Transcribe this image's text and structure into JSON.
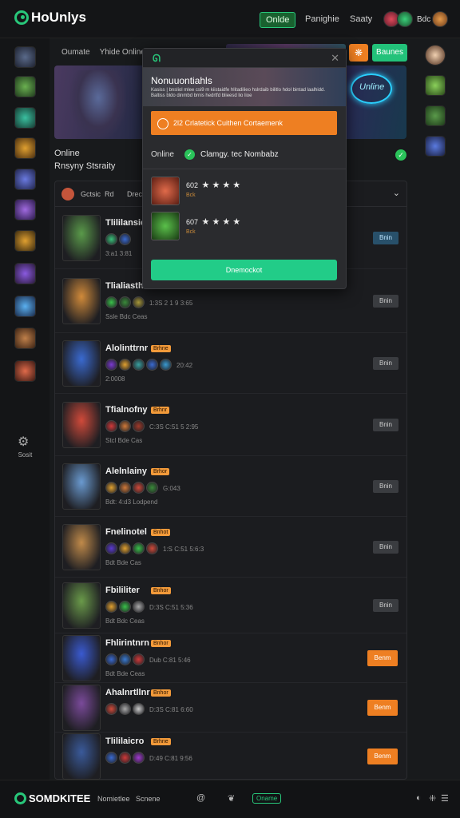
{
  "header": {
    "logo": "HoUnlys",
    "nav": [
      "Onlde",
      "Panighie",
      "Saaty"
    ],
    "user_label": "Bdc"
  },
  "subtabs": [
    "Oumate",
    "Yhide Online"
  ],
  "actions": {
    "green_btn": "Baunes",
    "orange_icon": "❋"
  },
  "page": {
    "online_label": "Online",
    "section_label": "Rnsyny Stsraity"
  },
  "list": {
    "head": [
      "Gctsic",
      "Rd",
      "Drec"
    ],
    "rows": [
      {
        "title": "Tlililansic",
        "stat": "",
        "meta": "3:a1 3:81",
        "action": "Bnin",
        "style": "blue",
        "badge": ""
      },
      {
        "title": "Tlialiasthr",
        "stat": "1:3S  2 1 9 3:65",
        "meta": "Ssle  Bdc  Ceas",
        "action": "Bnin",
        "style": "",
        "badge": ""
      },
      {
        "title": "Alolinttrnr",
        "stat": "20:42",
        "meta": "2:0008",
        "action": "Bnin",
        "style": "",
        "badge": "Brhne"
      },
      {
        "title": "Tfialnofny",
        "stat": "C:3S  C:51  5 2:95",
        "meta": "Stcl  Bde  Cas",
        "action": "Bnin",
        "style": "",
        "badge": "Brhnr"
      },
      {
        "title": "Alelnlainy",
        "stat": "G:043",
        "meta": "Bdt:  4:d3  Lodpend",
        "action": "Bnin",
        "style": "",
        "badge": "Brhor"
      },
      {
        "title": "Fnelinotel",
        "stat": "1:S  C:51 5:6:3",
        "meta": "Bdt  Bde  Cas",
        "action": "Bnin",
        "style": "",
        "badge": "Bnhot"
      },
      {
        "title": "Fbililiter",
        "stat": "D:3S  C:51 5:36",
        "meta": "Bdt  Bdc  Ceas",
        "action": "Bnin",
        "style": "",
        "badge": "Bnhor"
      },
      {
        "title": "Fhlirintnrn",
        "stat": "Dub  C:81 5:46",
        "meta": "Bdt  Bde  Ceas",
        "action": "Benm",
        "style": "orange",
        "badge": "Bnhor"
      },
      {
        "title": "Ahalnrtllnr",
        "stat": "D:3S  C:81 6:60",
        "meta": "",
        "action": "Benm",
        "style": "orange",
        "badge": "Bnhor"
      },
      {
        "title": "Tlililaicro",
        "stat": "D:49  C:81 9:56",
        "meta": "",
        "action": "Benm",
        "style": "orange",
        "badge": "Brhne"
      }
    ]
  },
  "popup": {
    "title": "Nonuuontiahls",
    "desc": "Kasiss | bnsliol mlee csi9 m kiistaidfe hlitadilieo hslrdaib bilitlo hdol bintad laalhidd. Baltiss bldo dinmbd brnis hedrtfd blieesd lio lioe",
    "banner": "2l2 Crlatetick Cuithen Cortaemenk",
    "online_label": "Online",
    "online_text": "Clamgy. tec Nombabz",
    "friends": [
      {
        "name": "602",
        "stars": "★ ★ ★ ★",
        "sub": "Bck"
      },
      {
        "name": "607",
        "stars": "★ ★ ★ ★",
        "sub": "Bck"
      }
    ],
    "button": "Dnemockot"
  },
  "footer": {
    "logo": "SOMDKITEE",
    "links": [
      "Nomietlee",
      "Scnene"
    ],
    "badge": "Oname",
    "icons": [
      "@",
      "❦"
    ]
  },
  "colors": {
    "accent": "#28c77a",
    "orange": "#ee7f22",
    "bg": "#181a1c"
  }
}
